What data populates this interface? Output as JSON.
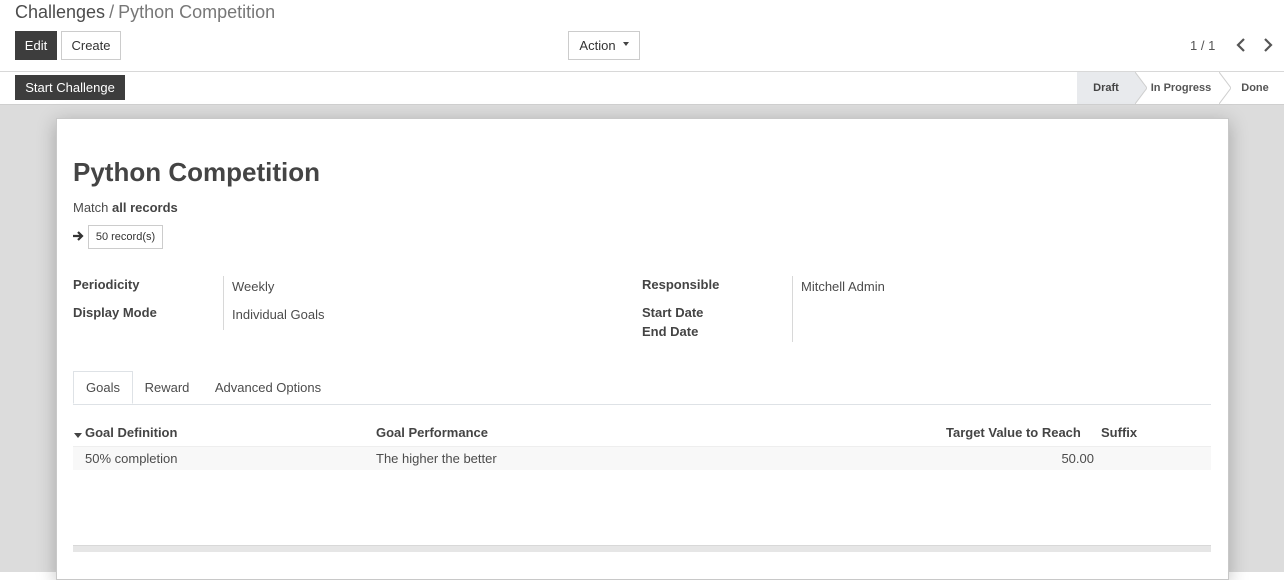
{
  "breadcrumb": {
    "parent": "Challenges",
    "separator": "/",
    "current": "Python Competition"
  },
  "toolbar": {
    "edit_label": "Edit",
    "create_label": "Create",
    "action_label": "Action"
  },
  "pager": {
    "value": "1 / 1"
  },
  "statusbar": {
    "start_label": "Start Challenge",
    "steps": [
      {
        "label": "Draft",
        "active": true
      },
      {
        "label": "In Progress",
        "active": false
      },
      {
        "label": "Done",
        "active": false
      }
    ]
  },
  "record": {
    "title": "Python Competition",
    "domain_prefix": "Match",
    "domain_value": "all records",
    "records_count": "50 record(s)",
    "fields": {
      "periodicity_label": "Periodicity",
      "periodicity_value": "Weekly",
      "display_mode_label": "Display Mode",
      "display_mode_value": "Individual Goals",
      "responsible_label": "Responsible",
      "responsible_value": "Mitchell Admin",
      "start_date_label": "Start Date",
      "end_date_label": "End Date"
    }
  },
  "tabs": [
    {
      "label": "Goals",
      "active": true
    },
    {
      "label": "Reward",
      "active": false
    },
    {
      "label": "Advanced Options",
      "active": false
    }
  ],
  "goals_table": {
    "columns": [
      "Goal Definition",
      "Goal Performance",
      "Target Value to Reach",
      "Suffix"
    ],
    "rows": [
      {
        "definition": "50% completion",
        "performance": "The higher the better",
        "target": "50.00",
        "suffix": ""
      }
    ]
  },
  "colors": {
    "primary_button": "#3d3d3d",
    "sheet_background": "#dcdcdc",
    "active_status": "#e8eaed"
  }
}
